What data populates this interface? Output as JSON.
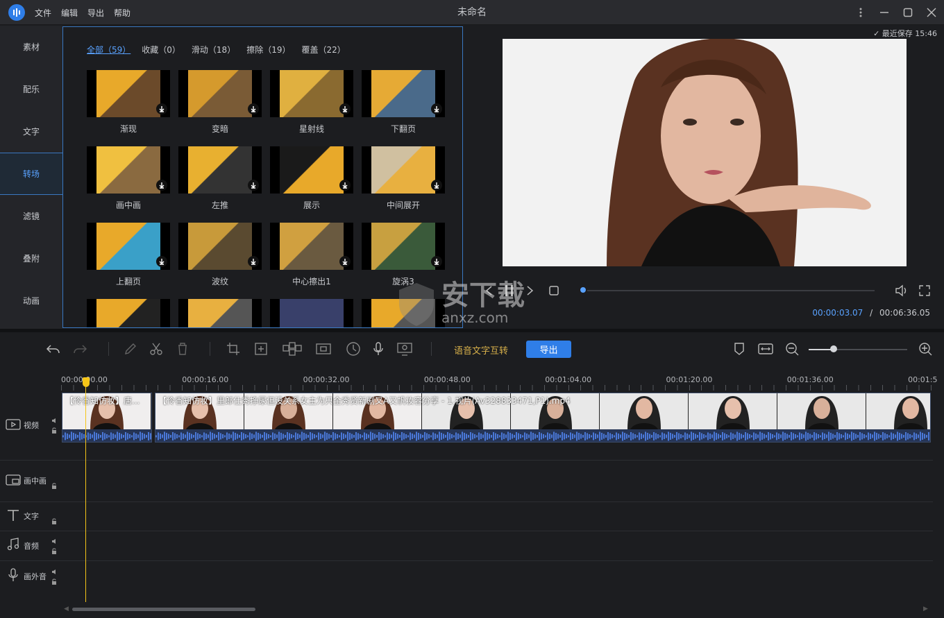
{
  "titlebar": {
    "title": "未命名",
    "menus": [
      "文件",
      "编辑",
      "导出",
      "帮助"
    ]
  },
  "sidebar": {
    "items": [
      {
        "label": "素材",
        "active": false
      },
      {
        "label": "配乐",
        "active": false
      },
      {
        "label": "文字",
        "active": false
      },
      {
        "label": "转场",
        "active": true
      },
      {
        "label": "滤镜",
        "active": false
      },
      {
        "label": "叠附",
        "active": false
      },
      {
        "label": "动画",
        "active": false
      }
    ]
  },
  "transitions": {
    "filters": [
      {
        "label": "全部（59）",
        "active": true
      },
      {
        "label": "收藏（0）",
        "active": false
      },
      {
        "label": "滑动（18）",
        "active": false
      },
      {
        "label": "擦除（19）",
        "active": false
      },
      {
        "label": "覆盖（22）",
        "active": false
      }
    ],
    "items": [
      "渐现",
      "变暗",
      "星射线",
      "下翻页",
      "画中画",
      "左推",
      "展示",
      "中间展开",
      "上翻页",
      "波纹",
      "中心擦出1",
      "旋涡3",
      "",
      "",
      "",
      ""
    ]
  },
  "preview": {
    "saved": "最近保存 15:46",
    "current_time": "00:00:03.07",
    "separator": "/",
    "total_time": "00:06:36.05",
    "progress": 0.01
  },
  "toolbar": {
    "speech_text": "语音文字互转",
    "export_label": "导出",
    "zoom_level": 0.25
  },
  "timeline": {
    "ruler": [
      "00:00:00.00",
      "00:00:16.00",
      "00:00:32.00",
      "00:00:48.00",
      "00:01:04.00",
      "00:01:20.00",
      "00:01:36.00",
      "00:01:5"
    ],
    "tracks": [
      "视频",
      "画中画",
      "文字",
      "音频",
      "画外音"
    ],
    "clips": [
      {
        "title": "【伶香知仿妆】唐...",
        "frames": 1
      },
      {
        "title": "【伶香知仿妆】里郎仕秀挣尿但没关系女主为只全秀贤新剧又A又帆妆容分享 - 1.视片(Av328833471,P1).mp4",
        "frames": 9
      }
    ]
  },
  "watermark": {
    "text": "安下载",
    "sub": "anxz.com"
  }
}
